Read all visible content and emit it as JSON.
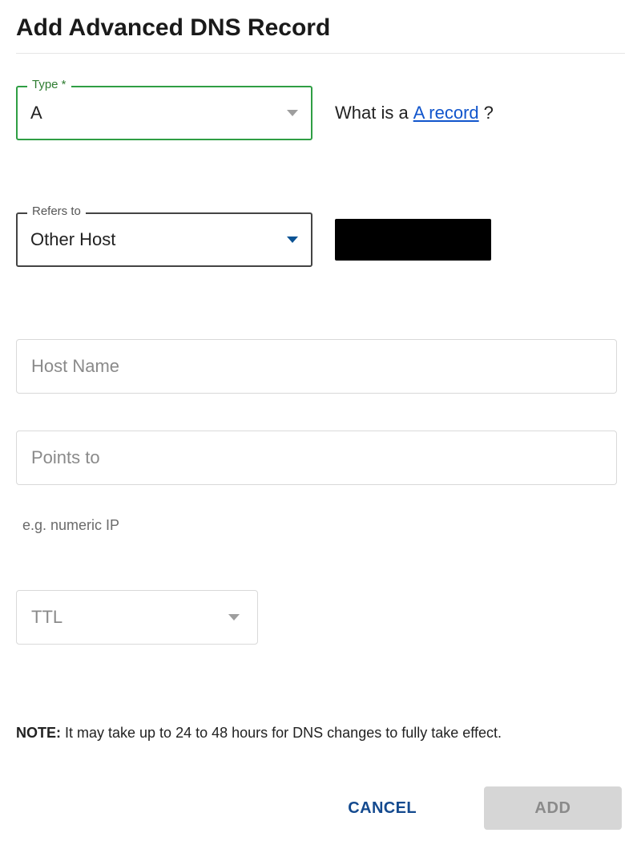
{
  "header": {
    "title": "Add Advanced DNS Record"
  },
  "type_field": {
    "label": "Type *",
    "value": "A"
  },
  "type_help": {
    "prefix": "What is a ",
    "link_text": "A record",
    "suffix": " ?"
  },
  "refers_field": {
    "label": "Refers to",
    "value": "Other Host"
  },
  "hostname_field": {
    "placeholder": "Host Name"
  },
  "pointsto_field": {
    "placeholder": "Points to"
  },
  "pointsto_hint": "e.g. numeric IP",
  "ttl_field": {
    "placeholder": "TTL"
  },
  "note": {
    "label": "NOTE:",
    "text": " It may take up to 24 to 48 hours for DNS changes to fully take effect."
  },
  "buttons": {
    "cancel": "CANCEL",
    "add": "ADD"
  }
}
